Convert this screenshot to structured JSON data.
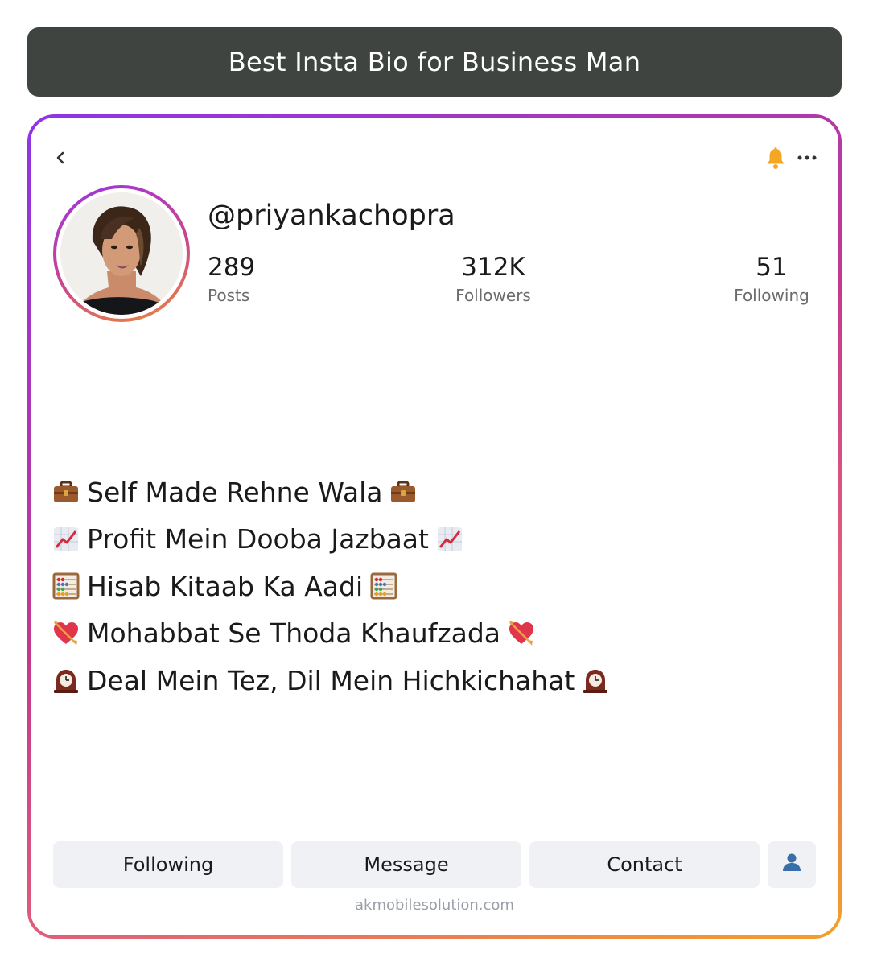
{
  "header": {
    "title": "Best Insta Bio for Business Man"
  },
  "profile": {
    "username": "@priyankachopra",
    "stats": {
      "posts": {
        "value": "289",
        "label": "Posts"
      },
      "followers": {
        "value": "312K",
        "label": "Followers"
      },
      "following": {
        "value": "51",
        "label": "Following"
      }
    }
  },
  "bio": {
    "lines": [
      {
        "icon": "briefcase-icon",
        "text": "Self Made Rehne Wala"
      },
      {
        "icon": "chart-increasing-icon",
        "text": "Profit Mein Dooba Jazbaat"
      },
      {
        "icon": "abacus-icon",
        "text": "Hisab Kitaab Ka Aadi"
      },
      {
        "icon": "heart-with-arrow-icon",
        "text": "Mohabbat Se Thoda Khaufzada"
      },
      {
        "icon": "mantelpiece-clock-icon",
        "text": "Deal Mein Tez, Dil Mein Hichkichahat"
      }
    ]
  },
  "actions": {
    "following_label": "Following",
    "message_label": "Message",
    "contact_label": "Contact",
    "person_icon": "person-icon"
  },
  "footer": {
    "watermark": "akmobilesolution.com"
  },
  "colors": {
    "title_bar": "#3f4440",
    "card_gradient_start": "#8e35e6",
    "card_gradient_end": "#f4a028",
    "bell": "#f5a623",
    "button_bg": "#eff1f4"
  }
}
